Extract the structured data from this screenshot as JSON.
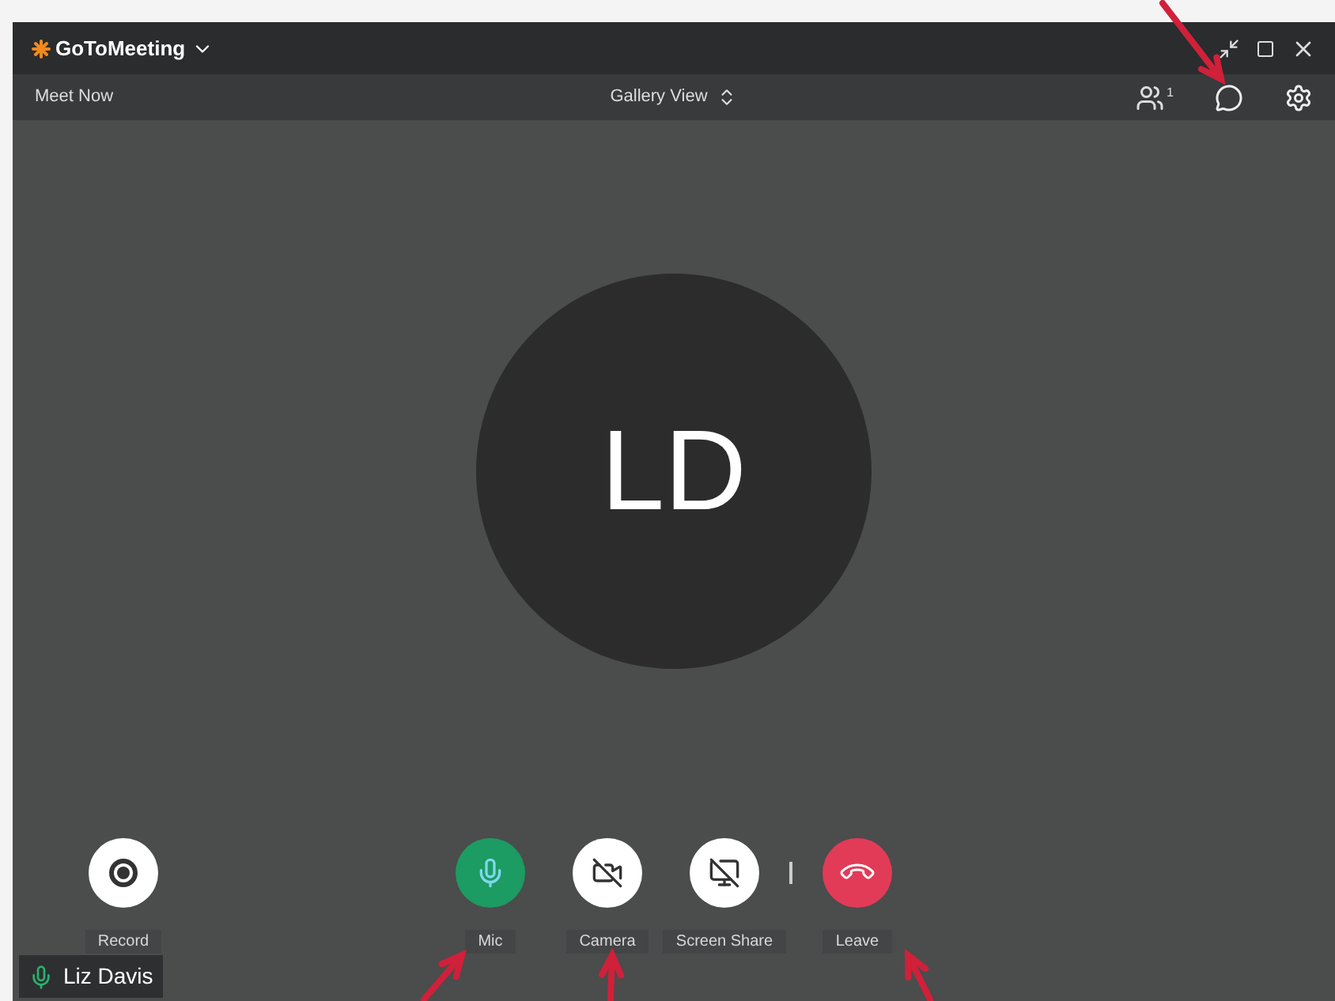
{
  "window": {
    "title": "GoToMeeting"
  },
  "toolbar": {
    "meeting": "Meet Now",
    "view": "Gallery View",
    "participant_count": "1"
  },
  "stage": {
    "initials": "LD"
  },
  "controls": [
    {
      "kind": "record",
      "label": "Record"
    },
    {
      "kind": "mic",
      "label": "Mic",
      "muted": false
    },
    {
      "kind": "camera",
      "label": "Camera",
      "on": false
    },
    {
      "kind": "screen_share",
      "label": "Screen Share"
    },
    {
      "kind": "leave",
      "label": "Leave"
    }
  ],
  "speaker": {
    "name": "Liz Davis",
    "muted": false
  }
}
